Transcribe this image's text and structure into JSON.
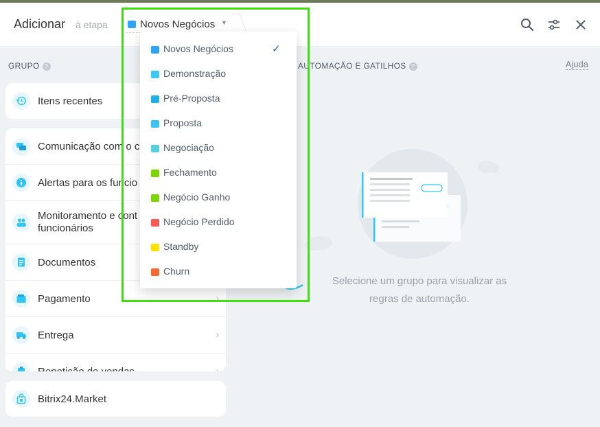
{
  "header": {
    "title": "Adicionar",
    "subtitle": "à etapa",
    "stage_selected": "Novos Negócios",
    "stage_color": "#2fa4f5"
  },
  "left": {
    "section_label": "GRUPO",
    "help_mark": "?",
    "recent": {
      "label": "Itens recentes",
      "icon": "history-icon"
    },
    "items": [
      {
        "label": "Comunicação com o c",
        "icon": "chat-icon"
      },
      {
        "label": "Alertas para os funcio",
        "icon": "info-icon"
      },
      {
        "label": "Monitoramento e cont",
        "label2": "funcionários",
        "icon": "people-icon"
      },
      {
        "label": "Documentos",
        "icon": "document-icon"
      },
      {
        "label": "Pagamento",
        "icon": "wallet-icon"
      },
      {
        "label": "Entrega",
        "icon": "truck-icon"
      },
      {
        "label": "Repetição de vendas",
        "icon": "repeat-icon"
      }
    ],
    "market": {
      "label": "Bitrix24.Market",
      "icon": "market-icon"
    }
  },
  "right": {
    "section_label": "AUTOMAÇÃO E GATILHOS",
    "help_mark": "?",
    "help_link": "Ajuda",
    "empty_line1": "Selecione um grupo para visualizar as",
    "empty_line2": "regras de automação."
  },
  "dropdown": {
    "options": [
      {
        "label": "Novos Negócios",
        "color": "#2fa4f5",
        "selected": true,
        "check": "✓"
      },
      {
        "label": "Demonstração",
        "color": "#3bc8f5"
      },
      {
        "label": "Pré-Proposta",
        "color": "#1eaee8"
      },
      {
        "label": "Proposta",
        "color": "#39c2f5"
      },
      {
        "label": "Negociação",
        "color": "#55d0e0"
      },
      {
        "label": "Fechamento",
        "color": "#7bd500"
      },
      {
        "label": "Negócio Ganho",
        "color": "#7bd500"
      },
      {
        "label": "Negócio Perdido",
        "color": "#ff5752"
      },
      {
        "label": "Standby",
        "color": "#ffe100"
      },
      {
        "label": "Churn",
        "color": "#f7692f"
      }
    ]
  },
  "highlight_color": "#3ee10f"
}
